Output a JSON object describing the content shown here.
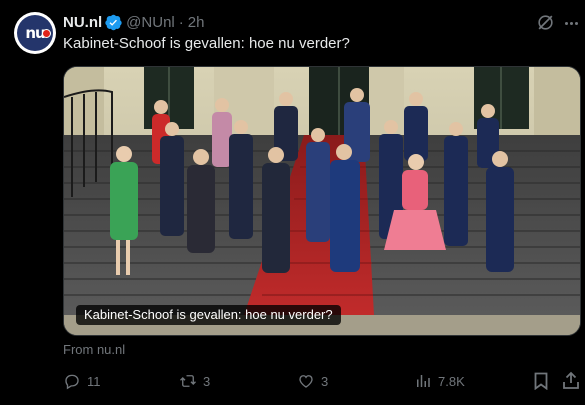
{
  "account": {
    "display_name": "NU.nl",
    "handle": "@NUnl",
    "time": "2h",
    "avatar_text": "nu",
    "verified_color": "#1d9bf0",
    "avatar_bg": "#24356b"
  },
  "tweet": {
    "text": "Kabinet-Schoof is gevallen: hoe nu verder?"
  },
  "media": {
    "caption": "Kabinet-Schoof is gevallen: hoe nu verder?",
    "description_icon": "photo"
  },
  "source": {
    "text": "From nu.nl"
  },
  "actions": {
    "reply_count": "11",
    "retweet_count": "3",
    "like_count": "3",
    "views_count": "7.8K"
  },
  "colors": {
    "background": "#000000",
    "text": "#e7e9ea",
    "muted": "#71767b",
    "border": "#2f3336",
    "carpet": "#b52626"
  }
}
